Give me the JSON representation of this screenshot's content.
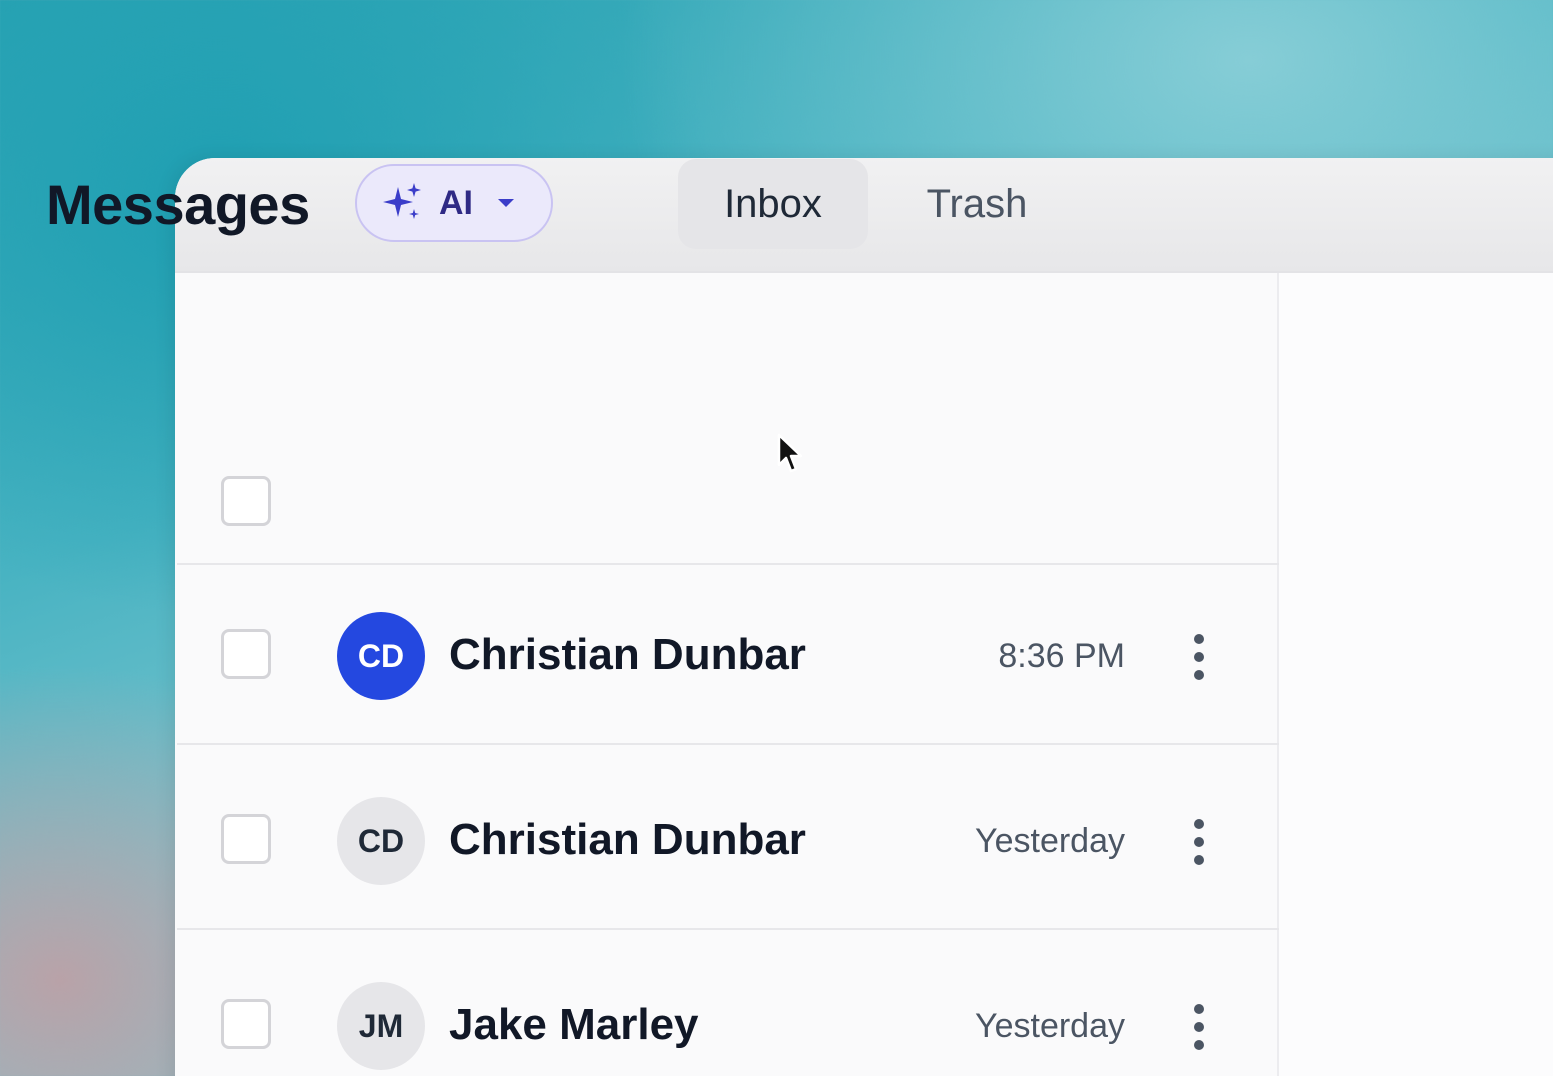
{
  "header": {
    "title": "Messages",
    "ai_button": {
      "label": "AI",
      "icon": "sparkle-icon",
      "dropdown_icon": "caret-down-icon"
    }
  },
  "tabs": [
    {
      "label": "Inbox",
      "active": true
    },
    {
      "label": "Trash",
      "active": false
    }
  ],
  "messages": [
    {
      "initials": "CD",
      "sender": "Christian Dunbar",
      "time": "8:36 PM",
      "avatar_color": "#2448e0"
    },
    {
      "initials": "CD",
      "sender": "Christian Dunbar",
      "time": "Yesterday",
      "avatar_color": "#e6e6e9"
    },
    {
      "initials": "JM",
      "sender": "Jake Marley",
      "time": "Yesterday",
      "avatar_color": "#e6e6e9"
    }
  ],
  "colors": {
    "accent": "#2448e0",
    "ai_pill_bg": "#ebe9fb",
    "ai_text": "#2f2a85"
  }
}
